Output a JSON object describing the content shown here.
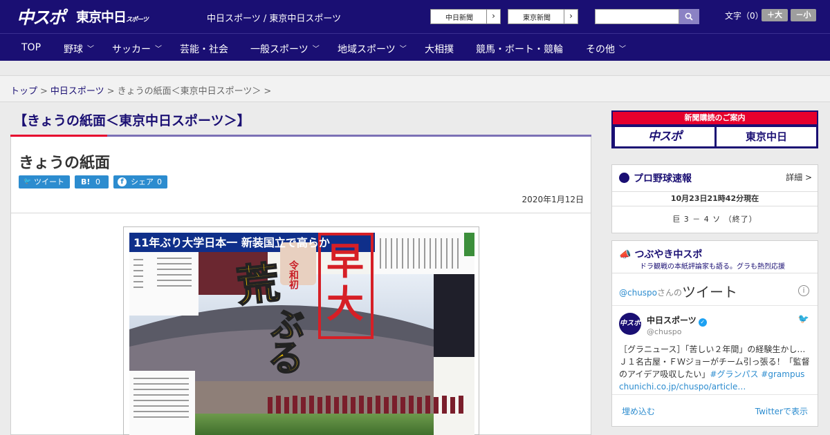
{
  "header": {
    "logo_chuspo": "中スポ",
    "logo_tokyo": "東京中日",
    "logo_tokyo_small": "スポーツ",
    "site_links": "中日スポーツ / 東京中日スポーツ",
    "btn_chunichi": "中日新聞",
    "btn_tokyo": "東京新聞",
    "arrow": "›",
    "search_placeholder": "",
    "font_size_label": "文字（0）",
    "font_plus": "＋大",
    "font_minus": "－小"
  },
  "nav": {
    "items": [
      {
        "label": "TOP",
        "chevron": ""
      },
      {
        "label": "野球",
        "chevron": "﹀"
      },
      {
        "label": "サッカー",
        "chevron": "﹀"
      },
      {
        "label": "芸能・社会",
        "chevron": ""
      },
      {
        "label": "一般スポーツ",
        "chevron": "﹀"
      },
      {
        "label": "地域スポーツ",
        "chevron": "﹀"
      },
      {
        "label": "大相撲",
        "chevron": ""
      },
      {
        "label": "競馬・ボート・競輪",
        "chevron": ""
      },
      {
        "label": "その他",
        "chevron": "﹀"
      }
    ]
  },
  "breadcrumb": {
    "top": "トップ",
    "sep": ">",
    "chunichi": "中日スポーツ",
    "current": "きょうの紙面＜東京中日スポーツ＞",
    "trailing": ">"
  },
  "page": {
    "heading": "【きょうの紙面＜東京中日スポーツ＞】",
    "article_title": "きょうの紙面",
    "date": "2020年1月12日"
  },
  "share": {
    "tweet_icon": "🐦",
    "tweet_label": "ツイート",
    "hatena_icon": "B!",
    "hatena_count": "0",
    "fb_icon": "f",
    "fb_label": "シェア",
    "fb_count": "0"
  },
  "newspaper": {
    "kicker": "11年ぶり大学日本一 新装国立で高らか",
    "reiwa": "令和初",
    "headline_red": "早大",
    "headline_yellow": "荒ぶる"
  },
  "sidebar": {
    "subscribe_title": "新聞購読のご案内",
    "subscribe_chuspo": "中スポ",
    "subscribe_tokyo": "東京中日",
    "baseball_title": "プロ野球速報",
    "baseball_detail": "詳細 >",
    "baseball_time": "10月23日21時42分現在",
    "baseball_score": "巨 3 － 4 ソ （終了）",
    "tweets_title": "つぶやき中スポ",
    "tweets_subtitle": "ドラ観戦の本紙評論家も語る。グラも熱烈応援",
    "tweets_handle_link": "@chuspo",
    "tweets_handle_suffix": "さんの",
    "tweets_handle_big": "ツイート",
    "info_icon": "i",
    "avatar_text": "中スポ",
    "tweet_name": "中日スポーツ",
    "verified_mark": "✓",
    "tweet_handle": "@chuspo",
    "tweet_body_1": "［グラニュース］「苦しい２年間」の経験生かし…Ｊ１名古屋・ＦＷジョーがチーム引っ張る！「監督のアイデア吸収したい」",
    "tweet_tag_1": "#グランパス",
    "tweet_tag_2": "#grampus",
    "tweet_link": "chunichi.co.jp/chuspo/article…",
    "embed_label": "埋め込む",
    "view_label": "Twitterで表示"
  }
}
